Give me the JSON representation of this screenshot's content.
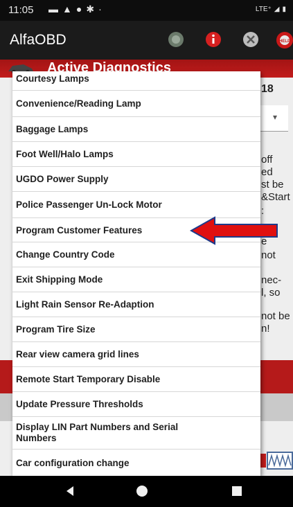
{
  "status_bar": {
    "time": "11:05",
    "network": "LTE⁺"
  },
  "app_bar": {
    "title": "AlfaOBD",
    "icons": [
      "globe-icon",
      "info-icon",
      "close-icon",
      "help-icon"
    ],
    "help_label": "HELP"
  },
  "sub_header": {
    "title": "Active Diagnostics"
  },
  "background": {
    "lines": [
      "18",
      "off",
      "ed",
      "st be",
      "&Start",
      ":",
      "e",
      "not",
      "nec-",
      "l, so",
      "not be",
      "n!"
    ]
  },
  "menu": {
    "items": [
      "Courtesy Lamps",
      "Convenience/Reading Lamp",
      "Baggage Lamps",
      "Foot Well/Halo Lamps",
      "UGDO Power Supply",
      "Police Passenger Un-Lock Motor",
      "Program Customer Features",
      "Change Country Code",
      "Exit Shipping Mode",
      "Light Rain Sensor Re-Adaption",
      "Program Tire Size",
      "Rear view camera grid lines",
      "Remote Start Temporary Disable",
      "Update Pressure Thresholds",
      "Display LIN Part Numbers and Serial Numbers",
      "Car configuration change"
    ],
    "highlighted_item": "Program Customer Features"
  },
  "colors": {
    "accent_red": "#c21c1c",
    "arrow_red": "#e01010",
    "arrow_outline": "#1e3a8a",
    "app_bar": "#1b1b1b"
  }
}
